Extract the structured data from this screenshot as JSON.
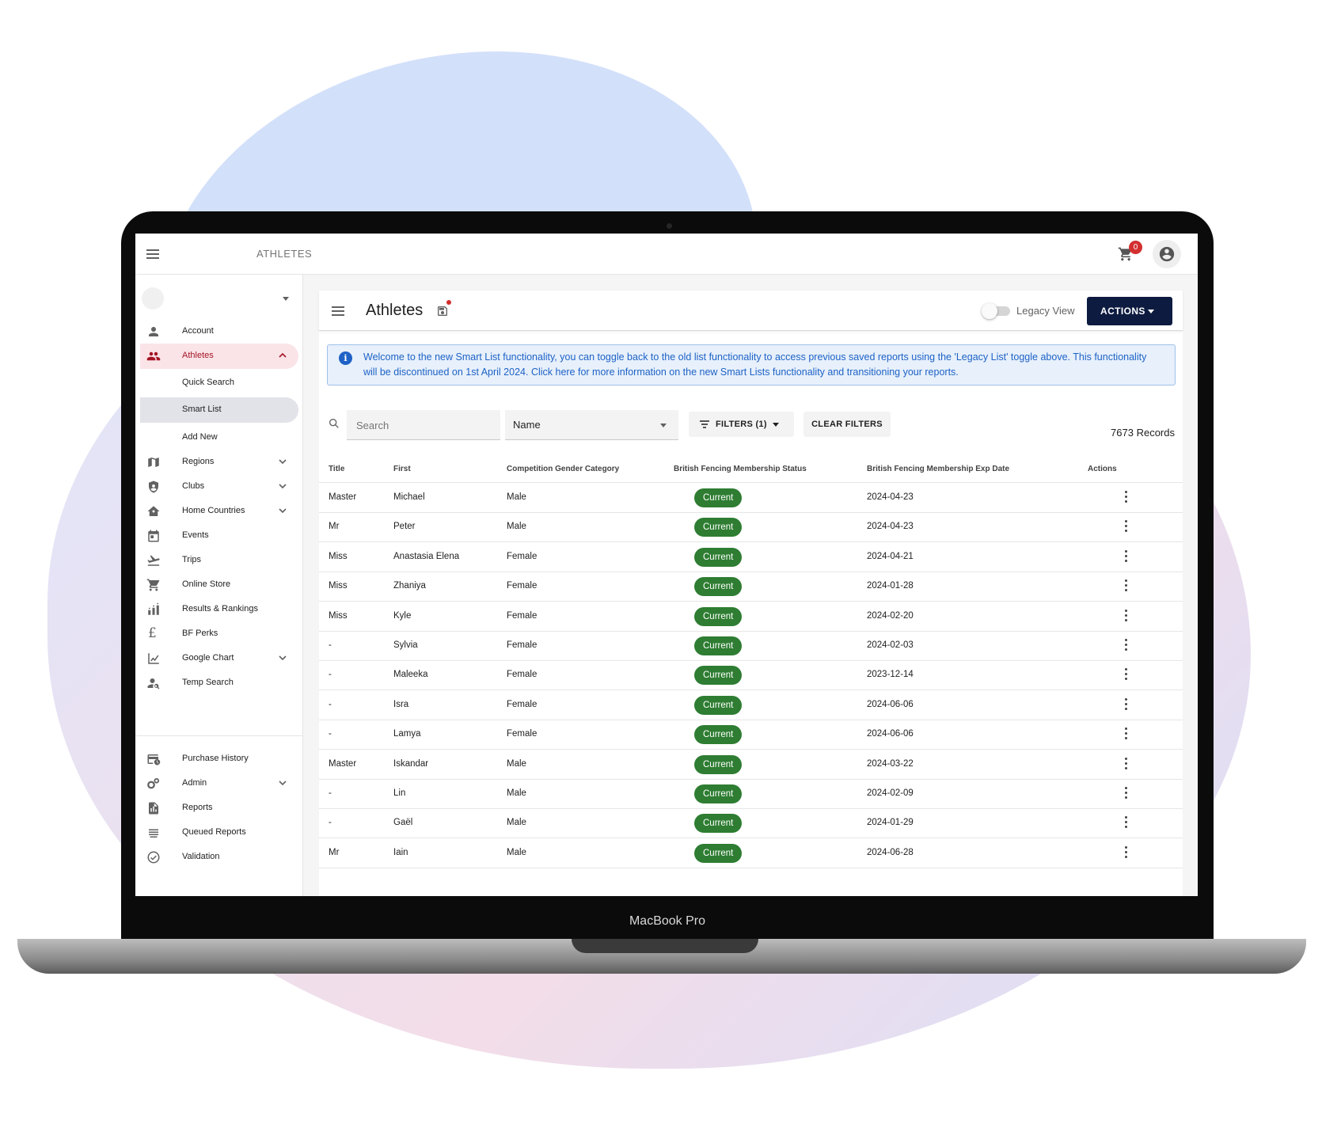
{
  "topbar": {
    "title": "ATHLETES",
    "cart_count": "0"
  },
  "sidebar": {
    "items": [
      {
        "label": "Account",
        "icon": "person-icon"
      },
      {
        "label": "Athletes",
        "icon": "group-icon",
        "active": true
      },
      {
        "label": "Quick Search"
      },
      {
        "label": "Smart List"
      },
      {
        "label": "Add New"
      },
      {
        "label": "Regions",
        "icon": "map-icon"
      },
      {
        "label": "Clubs",
        "icon": "shield-icon"
      },
      {
        "label": "Home Countries",
        "icon": "home-icon"
      },
      {
        "label": "Events",
        "icon": "calendar-icon"
      },
      {
        "label": "Trips",
        "icon": "plane-icon"
      },
      {
        "label": "Online Store",
        "icon": "cart-icon"
      },
      {
        "label": "Results & Rankings",
        "icon": "ranking-icon"
      },
      {
        "label": "BF Perks",
        "icon": "pound-icon"
      },
      {
        "label": "Google Chart",
        "icon": "chart-icon"
      },
      {
        "label": "Temp Search",
        "icon": "person-search-icon"
      },
      {
        "label": "Purchase History",
        "icon": "history-icon"
      },
      {
        "label": "Admin",
        "icon": "gears-icon"
      },
      {
        "label": "Reports",
        "icon": "report-icon"
      },
      {
        "label": "Queued Reports",
        "icon": "queue-icon"
      },
      {
        "label": "Validation",
        "icon": "check-circle-icon"
      }
    ]
  },
  "panel": {
    "title": "Athletes",
    "legacy_label": "Legacy View",
    "actions_label": "ACTIONS",
    "info_text": "Welcome to the new Smart List functionality, you can toggle back to the old list functionality to access previous saved reports using the 'Legacy List' toggle above. This functionality will be discontinued on 1st April 2024. Click here for more information on the new Smart Lists functionality and transitioning your reports.",
    "search_placeholder": "Search",
    "select_value": "Name",
    "filters_label": "FILTERS (1)",
    "clear_label": "CLEAR FILTERS",
    "records": "7673 Records"
  },
  "table": {
    "headers": [
      "Title",
      "First",
      "Competition Gender Category",
      "British Fencing Membership Status",
      "British Fencing Membership Exp Date",
      "Actions"
    ],
    "rows": [
      [
        "Master",
        "Michael",
        "Male",
        "Current",
        "2024-04-23"
      ],
      [
        "Mr",
        "Peter",
        "Male",
        "Current",
        "2024-04-23"
      ],
      [
        "Miss",
        "Anastasia Elena",
        "Female",
        "Current",
        "2024-04-21"
      ],
      [
        "Miss",
        "Zhaniya",
        "Female",
        "Current",
        "2024-01-28"
      ],
      [
        "Miss",
        "Kyle",
        "Female",
        "Current",
        "2024-02-20"
      ],
      [
        "-",
        "Sylvia",
        "Female",
        "Current",
        "2024-02-03"
      ],
      [
        "-",
        "Maleeka",
        "Female",
        "Current",
        "2023-12-14"
      ],
      [
        "-",
        "Isra",
        "Female",
        "Current",
        "2024-06-06"
      ],
      [
        "-",
        "Lamya",
        "Female",
        "Current",
        "2024-06-06"
      ],
      [
        "Master",
        "Iskandar",
        "Male",
        "Current",
        "2024-03-22"
      ],
      [
        "-",
        "Lin",
        "Male",
        "Current",
        "2024-02-09"
      ],
      [
        "-",
        "Gaël",
        "Male",
        "Current",
        "2024-01-29"
      ],
      [
        "Mr",
        "Iain",
        "Male",
        "Current",
        "2024-06-28"
      ]
    ]
  },
  "device": {
    "label": "MacBook Pro"
  },
  "colors": {
    "accent": "#0d1b40",
    "active_nav": "#a31525",
    "status_green": "#2e7d32",
    "info_blue": "#1e62c6"
  }
}
